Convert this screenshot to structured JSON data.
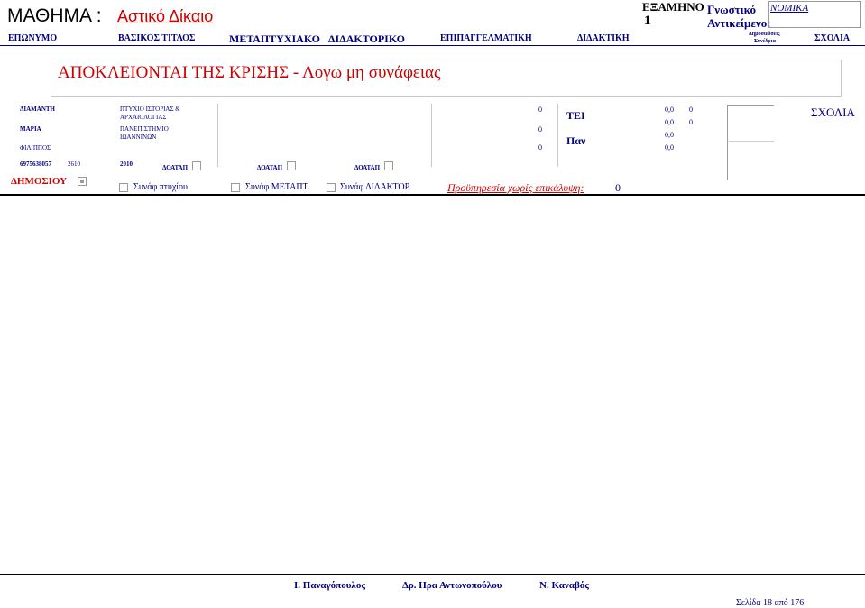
{
  "header": {
    "subject_label": "ΜΑΘΗΜΑ :",
    "subject_value": "Αστικό  Δίκαιο",
    "semester_label": "ΕΞΑΜΗΝΟ",
    "semester_value": "1",
    "area_label_line1": "Γνωστικό",
    "area_label_line2": "Αντικείμενο:",
    "area_value": "ΝΟΜΙΚΑ"
  },
  "columns": {
    "surname": "ΕΠΩΝΥΜΟ",
    "main_degree": "ΒΑΣΙΚΟΣ ΤΙΤΛΟΣ",
    "masters": "ΜΕΤΑΠΤΥΧΙΑΚΟ",
    "doctorate": "ΔΙΔΑΚΤΟΡΙΚΟ",
    "professional": "ΕΠΙΠΑΓΓΕΛΜΑΤΙΚΗ",
    "teaching": "ΔΙΔΑΚΤΙΚΗ",
    "publications_line1": "Δημοσιεύσεις",
    "publications_line2": "Συνέδρια",
    "comments": "ΣΧΟΛΙΑ"
  },
  "banner": "ΑΠΟΚΛΕΙΟΝΤΑΙ ΤΗΣ ΚΡΙΣΗΣ - Λογω μη συνάφειας",
  "record": {
    "surname": "ΔΙΑΜΑΝΤΗ",
    "first_name": "ΜΑΡΙΑ",
    "father_name": "ΦΙΛΙΠΠΟΣ",
    "phone": "6975638057",
    "code": "2610",
    "degree_line1": "ΠΤΥΧΙΟ ΙΣΤΟΡΙΑΣ &",
    "degree_line2": "ΑΡΧΑΙΟΛΟΓΙΑΣ",
    "university_line1": "ΠΑΝΕΠΙΣΤΗΜΙΟ",
    "university_line2": "ΙΩΑΝΝΙΝΩΝ",
    "degree_year": "2010",
    "doatap_1": "ΔΟΑΤΑΠ",
    "doatap_2": "ΔΟΑΤΑΠ",
    "doatap_3": "ΔΟΑΤΑΠ",
    "public_sector": "ΔΗΜΟΣΙΟΥ",
    "relevance_degree": "Συνάφ πτυχίου",
    "relevance_masters": "Συνάφ ΜΕΤΑΠΤ.",
    "relevance_doctorate": "Συνάφ ΔΙΔΑΚΤΟΡ.",
    "prior_service_label": "Προϋπηρεσία χωρίς επικάλυψη:",
    "prior_service_value": "0",
    "prof_values": [
      "0",
      "0",
      "0"
    ],
    "tei_label": "ΤΕΙ",
    "pan_label": "Παν",
    "teach_col1": [
      "0,0",
      "0,0",
      "0,0",
      "0,0"
    ],
    "teach_col2": [
      "0",
      "0"
    ],
    "comments": "ΣΧΟΛΙΑ"
  },
  "footer": {
    "signer_1": "Ι. Παναγόπουλος",
    "signer_2": "Δρ. Ηρα Αντωνοπούλου",
    "signer_3": "Ν. Καναβός",
    "page_info": "Σελίδα 18 από 176"
  }
}
